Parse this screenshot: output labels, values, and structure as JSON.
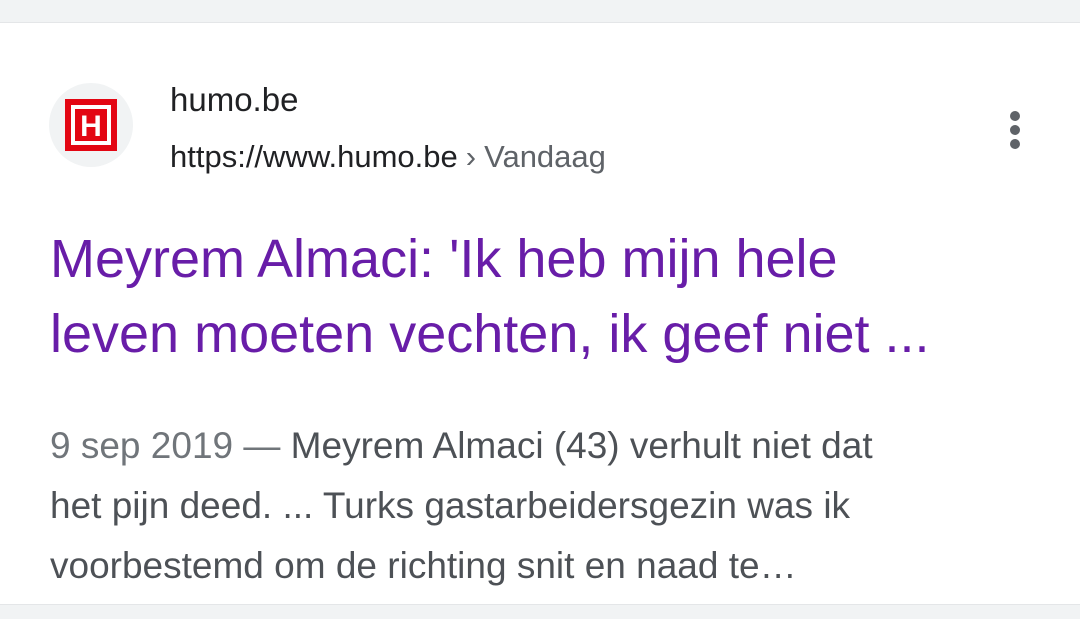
{
  "result": {
    "site_name": "humo.be",
    "url": "https://www.humo.be",
    "breadcrumb_separator": "›",
    "breadcrumb": "Vandaag",
    "favicon_letter": "H",
    "favicon_icon": "humo-logo-icon",
    "title_line1": "Meyrem Almaci: 'Ik heb mijn hele",
    "title_line2": "leven moeten vechten, ik geef niet ...",
    "date": "9 sep 2019",
    "date_separator": " — ",
    "snippet_line1_rest": "Meyrem Almaci (43) verhult niet dat",
    "snippet_line2": "het pijn deed. ... Turks gastarbeidersgezin was ik",
    "snippet_line3": "voorbestemd om de richting snit en naad te…",
    "more_icon": "more-vert-icon"
  },
  "colors": {
    "title_visited": "#681da8",
    "snippet": "#4d5156",
    "logo_red": "#e30613"
  }
}
